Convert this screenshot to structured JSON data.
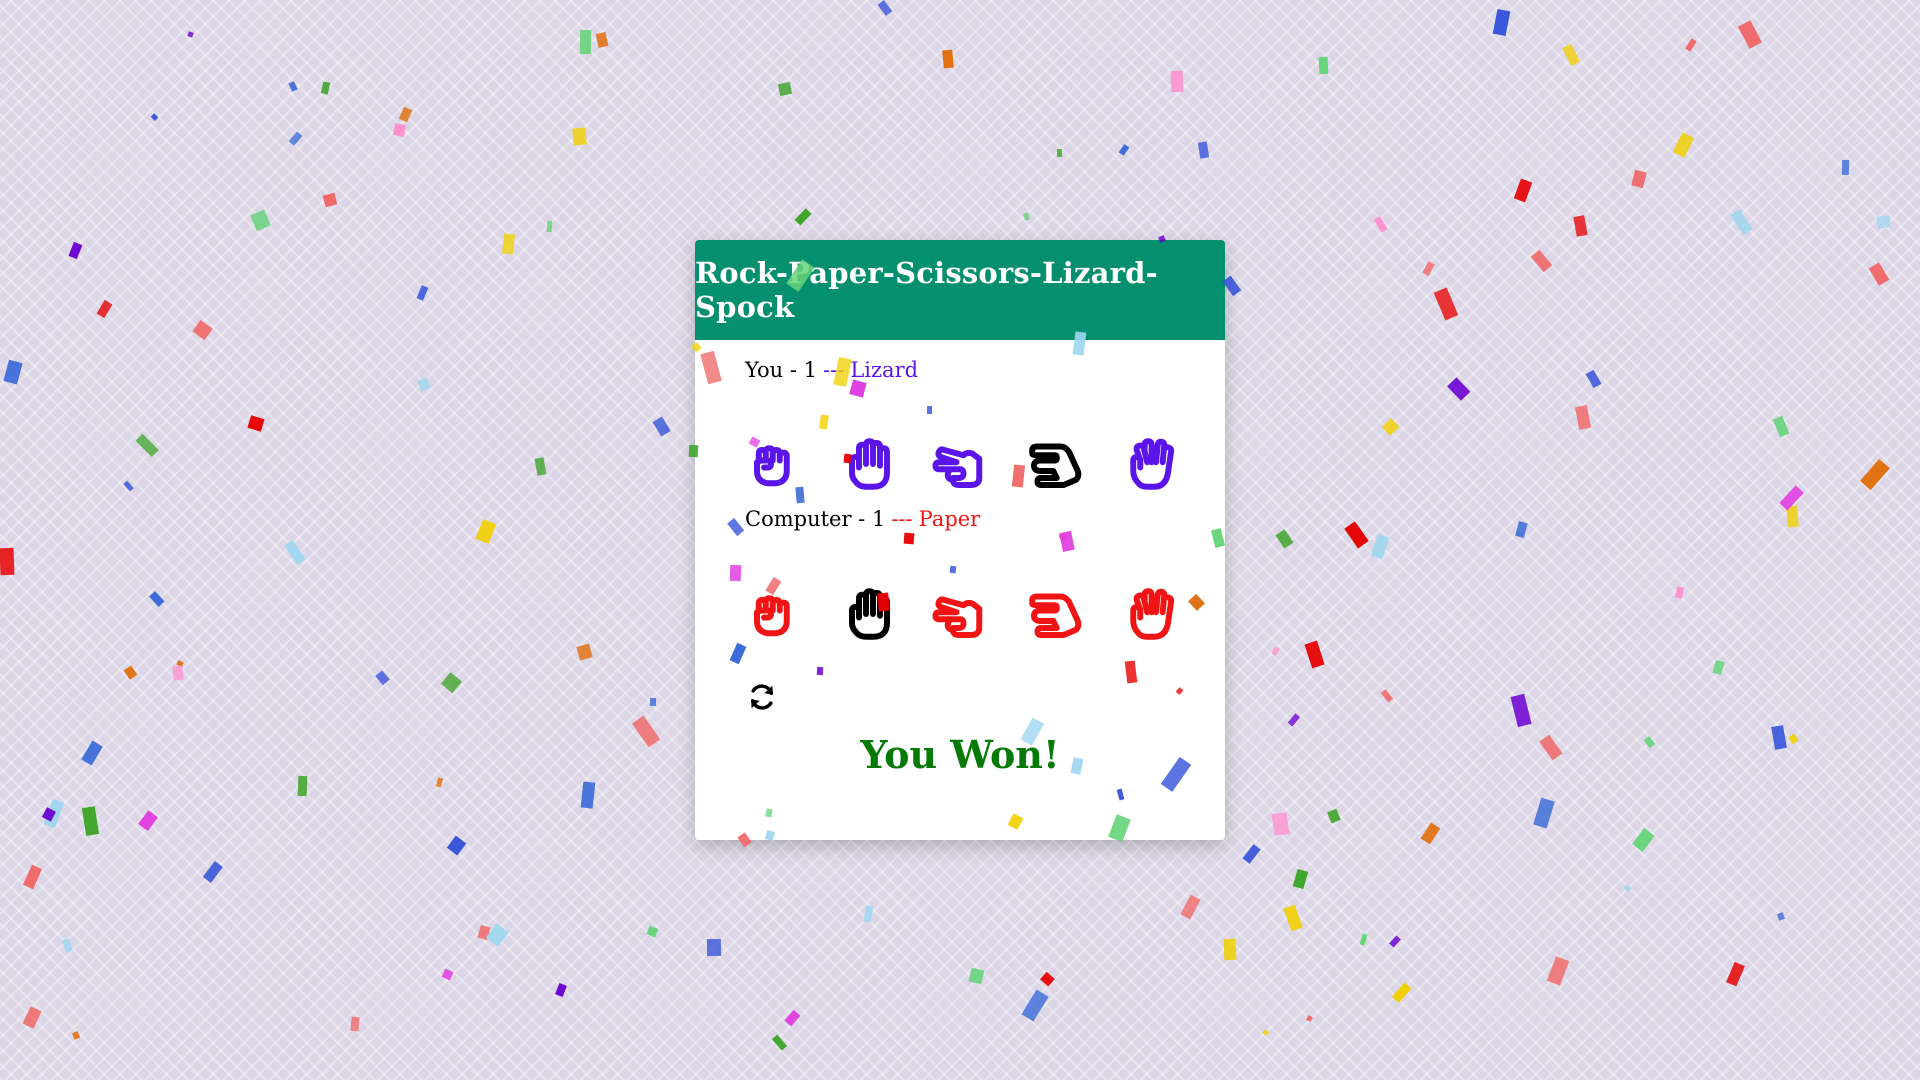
{
  "title": "Rock-Paper-Scissors-Lizard-Spock",
  "colors": {
    "header": "#048f6f",
    "player": "#5b14e8",
    "computer": "#f01414",
    "selected": "#000000",
    "win": "#067a06"
  },
  "player": {
    "name": "You",
    "score_text": " - 1",
    "separator": "---",
    "choice": "Lizard",
    "selected": "lizard"
  },
  "computer": {
    "name": "Computer",
    "score_text": " - 1",
    "separator": "---",
    "choice": "Paper",
    "selected": "paper"
  },
  "choices": [
    {
      "id": "rock",
      "icon": "rock-hand-icon"
    },
    {
      "id": "paper",
      "icon": "paper-hand-icon"
    },
    {
      "id": "scissors",
      "icon": "scissors-hand-icon"
    },
    {
      "id": "lizard",
      "icon": "lizard-hand-icon"
    },
    {
      "id": "spock",
      "icon": "spock-hand-icon"
    }
  ],
  "reset": {
    "icon": "refresh-icon"
  },
  "result": "You Won!"
}
